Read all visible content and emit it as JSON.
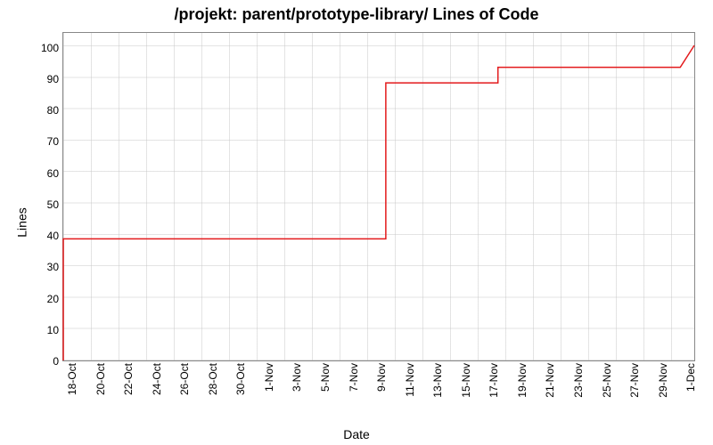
{
  "chart_data": {
    "type": "line",
    "title": "/projekt: parent/prototype-library/ Lines of Code",
    "xlabel": "Date",
    "ylabel": "Lines",
    "ylim": [
      0,
      105
    ],
    "y_ticks": [
      0,
      10,
      20,
      30,
      40,
      50,
      60,
      70,
      80,
      90,
      100
    ],
    "x_ticks": [
      "18-Oct",
      "20-Oct",
      "22-Oct",
      "24-Oct",
      "26-Oct",
      "28-Oct",
      "30-Oct",
      "1-Nov",
      "3-Nov",
      "5-Nov",
      "7-Nov",
      "9-Nov",
      "11-Nov",
      "13-Nov",
      "15-Nov",
      "17-Nov",
      "19-Nov",
      "21-Nov",
      "23-Nov",
      "25-Nov",
      "27-Nov",
      "29-Nov",
      "1-Dec"
    ],
    "series": [
      {
        "name": "Lines of Code",
        "color": "#e31a1c",
        "points": [
          {
            "x": "18-Oct",
            "y": 0
          },
          {
            "x": "18-Oct",
            "y": 39
          },
          {
            "x": "10-Nov",
            "y": 39
          },
          {
            "x": "10-Nov",
            "y": 89
          },
          {
            "x": "18-Nov",
            "y": 89
          },
          {
            "x": "18-Nov",
            "y": 94
          },
          {
            "x": "1-Dec",
            "y": 94
          },
          {
            "x": "2-Dec",
            "y": 101
          }
        ]
      }
    ],
    "x_days_domain": [
      0,
      45
    ]
  }
}
